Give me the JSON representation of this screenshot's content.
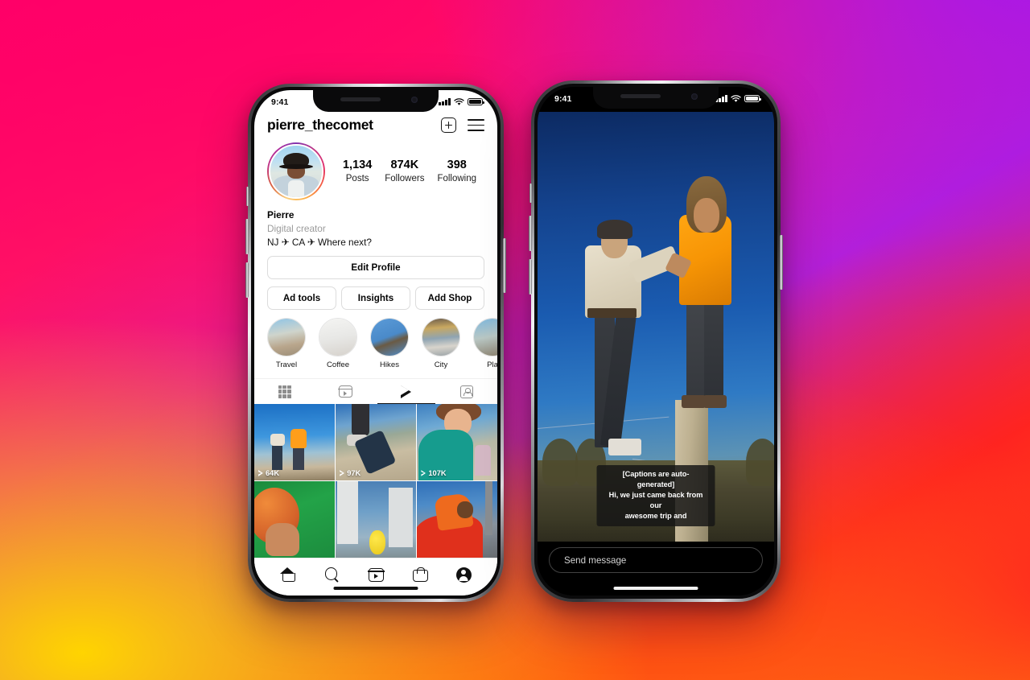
{
  "background": {
    "gradient_colors": [
      "#FF0066",
      "#E81C8C",
      "#B420D8",
      "#A818EA",
      "#FF2A20",
      "#FF5C10",
      "#FFC800"
    ],
    "description": "Instagram brand gradient"
  },
  "phone1": {
    "status_bar": {
      "time": "9:41",
      "signal_icon": "cellular-bars-icon",
      "wifi_icon": "wifi-icon",
      "battery_icon": "battery-icon"
    },
    "header": {
      "username": "pierre_thecomet",
      "add_icon": "plus-square-icon",
      "menu_icon": "hamburger-menu-icon"
    },
    "profile": {
      "avatar_label": "avatar",
      "stats": [
        {
          "number": "1,134",
          "label": "Posts"
        },
        {
          "number": "874K",
          "label": "Followers"
        },
        {
          "number": "398",
          "label": "Following"
        }
      ],
      "bio_name": "Pierre",
      "bio_category": "Digital creator",
      "bio_text": "NJ ✈ CA ✈ Where next?"
    },
    "buttons": {
      "edit_profile": "Edit Profile",
      "ad_tools": "Ad tools",
      "insights": "Insights",
      "add_shop": "Add Shop"
    },
    "highlights": [
      {
        "label": "Travel"
      },
      {
        "label": "Coffee"
      },
      {
        "label": "Hikes"
      },
      {
        "label": "City"
      },
      {
        "label": "Pla"
      }
    ],
    "tabs": [
      {
        "icon": "grid-icon",
        "active": false
      },
      {
        "icon": "reels-icon",
        "active": false
      },
      {
        "icon": "play-icon",
        "active": true
      },
      {
        "icon": "tagged-icon",
        "active": false
      }
    ],
    "reels": [
      {
        "views": "64K"
      },
      {
        "views": "97K"
      },
      {
        "views": "107K"
      },
      {
        "views": ""
      },
      {
        "views": ""
      },
      {
        "views": ""
      }
    ],
    "nav": [
      {
        "icon": "home-icon"
      },
      {
        "icon": "search-icon"
      },
      {
        "icon": "reels-icon"
      },
      {
        "icon": "shop-icon"
      },
      {
        "icon": "profile-icon"
      }
    ]
  },
  "phone2": {
    "status_bar": {
      "time": "9:41",
      "signal_icon": "cellular-bars-icon",
      "wifi_icon": "wifi-icon",
      "battery_icon": "battery-icon"
    },
    "captions": {
      "line1": "[Captions are auto-generated]",
      "line2": "Hi, we just came back from our",
      "line3": "awesome trip and"
    },
    "message_input": {
      "placeholder": "Send message"
    }
  }
}
